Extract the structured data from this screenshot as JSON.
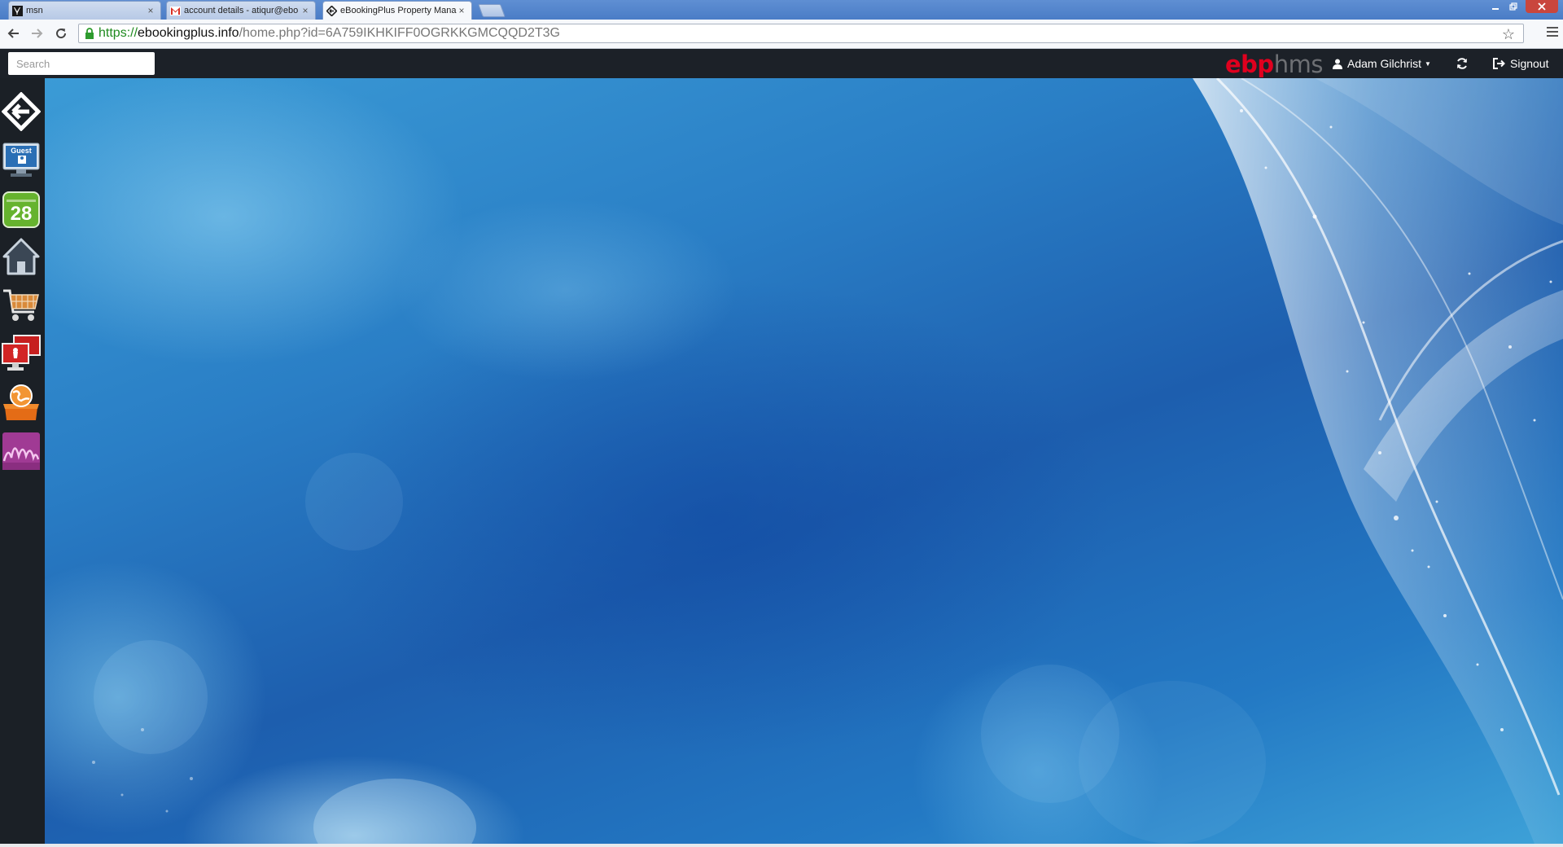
{
  "browser": {
    "tabs": [
      {
        "title": "msn",
        "icon": "msn-icon",
        "active": false
      },
      {
        "title": "account details - atiqur@ebo",
        "icon": "gmail-icon",
        "active": false
      },
      {
        "title": "eBookingPlus Property Mana",
        "icon": "ebookingplus-icon",
        "active": true
      }
    ],
    "url": {
      "scheme": "https://",
      "host": "ebookingplus.info",
      "path": "/home.php?id=6A759IKHKIFF0OGRKKGMCQQD2T3G"
    }
  },
  "appbar": {
    "search_placeholder": "Search",
    "brand_part1": "ebp",
    "brand_part2": "hms",
    "user_name": "Adam Gilchrist",
    "signout_label": "Signout",
    "brand_color": "#e0001e"
  },
  "sidebar": {
    "items": [
      {
        "name": "ebp-logo",
        "icon": "ebp-logo-icon"
      },
      {
        "name": "guest",
        "icon": "guest-monitor-icon",
        "label": "Guest"
      },
      {
        "name": "calendar",
        "icon": "calendar-icon",
        "day": "28"
      },
      {
        "name": "property",
        "icon": "house-icon"
      },
      {
        "name": "shop",
        "icon": "shopping-cart-icon"
      },
      {
        "name": "front-desk",
        "icon": "monitor-icon"
      },
      {
        "name": "booking-engine",
        "icon": "globe-box-icon"
      },
      {
        "name": "reports",
        "icon": "chart-icon"
      }
    ]
  }
}
